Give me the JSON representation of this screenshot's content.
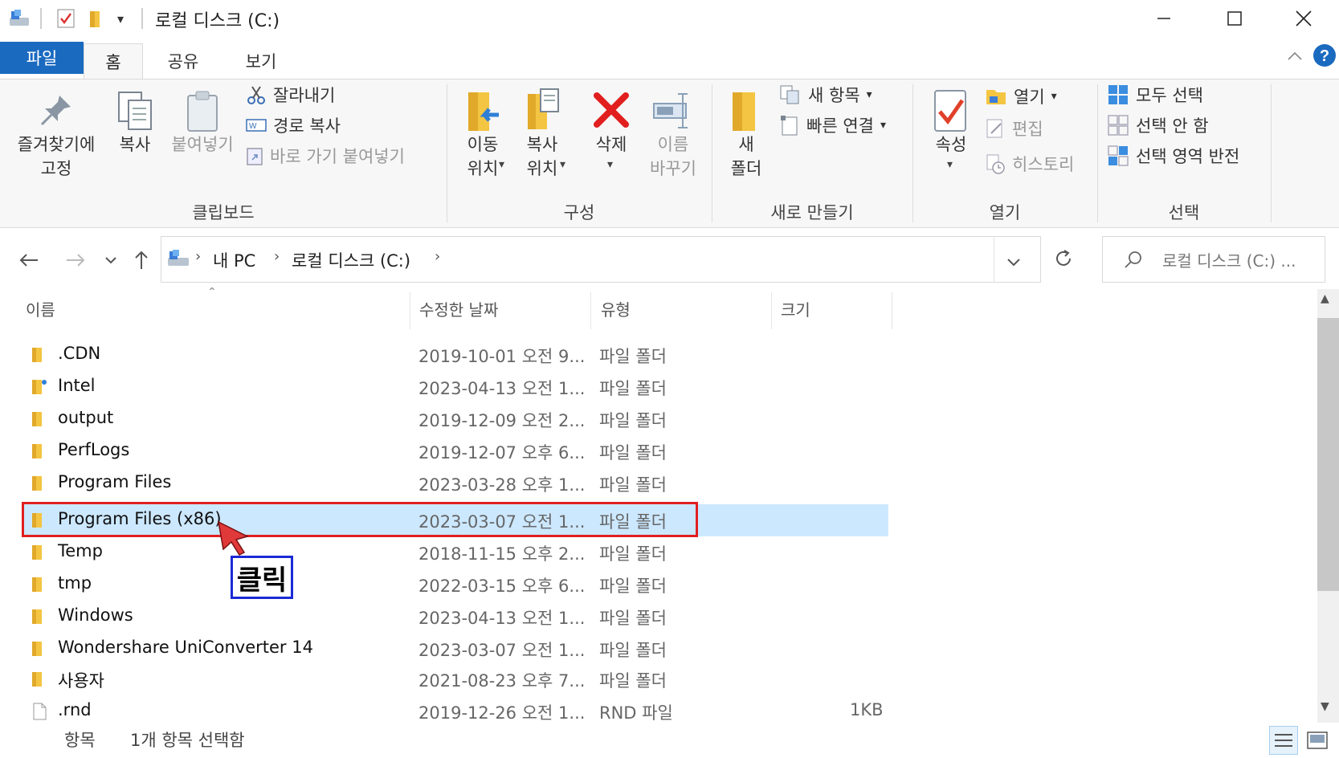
{
  "window": {
    "title": "로컬 디스크 (C:)"
  },
  "ribbon_tabs": {
    "file": "파일",
    "home": "홈",
    "share": "공유",
    "view": "보기"
  },
  "ribbon": {
    "clipboard": {
      "group_label": "클립보드",
      "pin_label_1": "즐겨찾기에",
      "pin_label_2": "고정",
      "copy": "복사",
      "paste": "붙여넣기",
      "cut": "잘라내기",
      "copy_path": "경로 복사",
      "paste_shortcut": "바로 가기 붙여넣기"
    },
    "organize": {
      "group_label": "구성",
      "move_to_1": "이동",
      "move_to_2": "위치",
      "copy_to_1": "복사",
      "copy_to_2": "위치",
      "delete": "삭제",
      "rename_1": "이름",
      "rename_2": "바꾸기"
    },
    "new": {
      "group_label": "새로 만들기",
      "new_folder_1": "새",
      "new_folder_2": "폴더",
      "new_item": "새 항목",
      "easy_access": "빠른 연결"
    },
    "open": {
      "group_label": "열기",
      "properties": "속성",
      "open": "열기",
      "edit": "편집",
      "history": "히스토리"
    },
    "select": {
      "group_label": "선택",
      "select_all": "모두 선택",
      "select_none": "선택 안 함",
      "invert": "선택 영역 반전"
    }
  },
  "address": {
    "crumbs": [
      "내 PC",
      "로컬 디스크 (C:)"
    ],
    "search_placeholder": "로컬 디스크 (C:) ..."
  },
  "columns": {
    "name": "이름",
    "date": "수정한 날짜",
    "type": "유형",
    "size": "크기"
  },
  "files": [
    {
      "name": ".CDN",
      "date": "2019-10-01 오전 9...",
      "type": "파일 폴더",
      "size": ""
    },
    {
      "name": "Intel",
      "date": "2023-04-13 오전 1...",
      "type": "파일 폴더",
      "size": ""
    },
    {
      "name": "output",
      "date": "2019-12-09 오전 2...",
      "type": "파일 폴더",
      "size": ""
    },
    {
      "name": "PerfLogs",
      "date": "2019-12-07 오후 6...",
      "type": "파일 폴더",
      "size": ""
    },
    {
      "name": "Program Files",
      "date": "2023-03-28 오후 1...",
      "type": "파일 폴더",
      "size": ""
    },
    {
      "name": "Program Files (x86)",
      "date": "2023-03-07 오전 1...",
      "type": "파일 폴더",
      "size": ""
    },
    {
      "name": "Temp",
      "date": "2018-11-15 오후 2...",
      "type": "파일 폴더",
      "size": ""
    },
    {
      "name": "tmp",
      "date": "2022-03-15 오후 6...",
      "type": "파일 폴더",
      "size": ""
    },
    {
      "name": "Windows",
      "date": "2023-04-13 오전 1...",
      "type": "파일 폴더",
      "size": ""
    },
    {
      "name": "Wondershare UniConverter 14",
      "date": "2023-03-07 오전 1...",
      "type": "파일 폴더",
      "size": ""
    },
    {
      "name": "사용자",
      "date": "2021-08-23 오후 7...",
      "type": "파일 폴더",
      "size": ""
    },
    {
      "name": ".rnd",
      "date": "2019-12-26 오전 1...",
      "type": "RND 파일",
      "size": "1KB"
    }
  ],
  "annotation": {
    "click_label": "클릭"
  },
  "status": {
    "items": "항목",
    "selected": "1개 항목 선택함"
  },
  "colors": {
    "accent": "#1a6ac0",
    "selection": "#cce8ff",
    "highlight_box": "#e02020",
    "label_box": "#1b2ad6"
  }
}
